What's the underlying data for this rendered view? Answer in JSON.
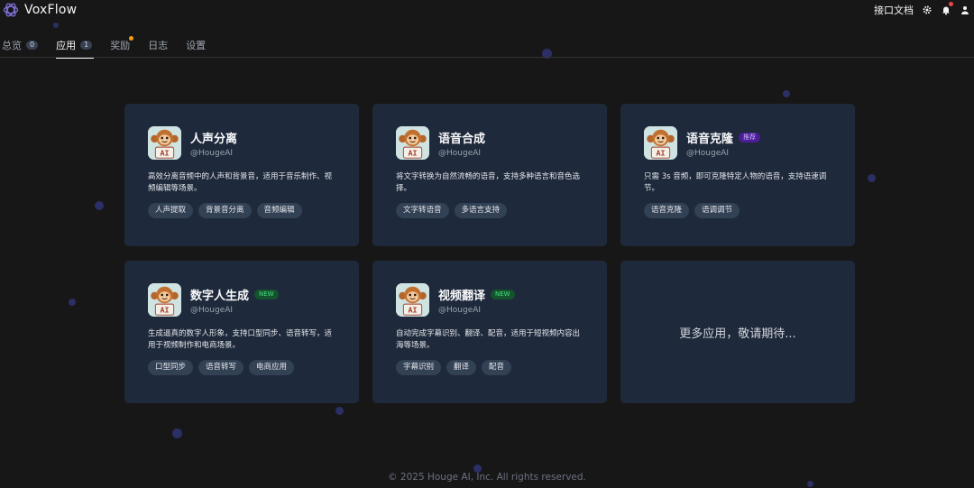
{
  "app": {
    "name": "VoxFlow"
  },
  "header": {
    "docs_label": "接口文档"
  },
  "colors": {
    "background": "#171717",
    "card": "#1e293b",
    "new_badge": "#4ade80",
    "recommend_badge": "#c4b5fd"
  },
  "tabs": [
    {
      "label": "总览",
      "count": "0",
      "active": false
    },
    {
      "label": "应用",
      "count": "1",
      "active": true
    },
    {
      "label": "奖励",
      "count": "",
      "active": false,
      "has_dot": true
    },
    {
      "label": "日志",
      "count": "",
      "active": false
    },
    {
      "label": "设置",
      "count": "",
      "active": false
    }
  ],
  "apps": [
    {
      "name": "人声分离",
      "author": "@HougeAI",
      "badge": "",
      "description": "高效分离音频中的人声和背景音，适用于音乐制作、视频编辑等场景。",
      "tags": [
        "人声提取",
        "背景音分离",
        "音频编辑"
      ]
    },
    {
      "name": "语音合成",
      "author": "@HougeAI",
      "badge": "",
      "description": "将文字转换为自然流畅的语音，支持多种语言和音色选择。",
      "tags": [
        "文字转语音",
        "多语言支持"
      ]
    },
    {
      "name": "语音克隆",
      "author": "@HougeAI",
      "badge": "推荐",
      "description": "只需 3s 音频，即可克隆特定人物的语音，支持语速调节。",
      "tags": [
        "语音克隆",
        "语调调节"
      ]
    },
    {
      "name": "数字人生成",
      "author": "@HougeAI",
      "badge": "NEW",
      "description": "生成逼真的数字人形象，支持口型同步、语音转写，适用于视频制作和电商场景。",
      "tags": [
        "口型同步",
        "语音转写",
        "电商应用"
      ]
    },
    {
      "name": "视频翻译",
      "author": "@HougeAI",
      "badge": "NEW",
      "description": "自动完成字幕识别、翻译、配音，适用于短视频内容出海等场景。",
      "tags": [
        "字幕识别",
        "翻译",
        "配音"
      ]
    }
  ],
  "coming_soon": "更多应用，敬请期待...",
  "avatar_text": "AI",
  "footer": "© 2025 Houge AI, Inc. All rights reserved."
}
